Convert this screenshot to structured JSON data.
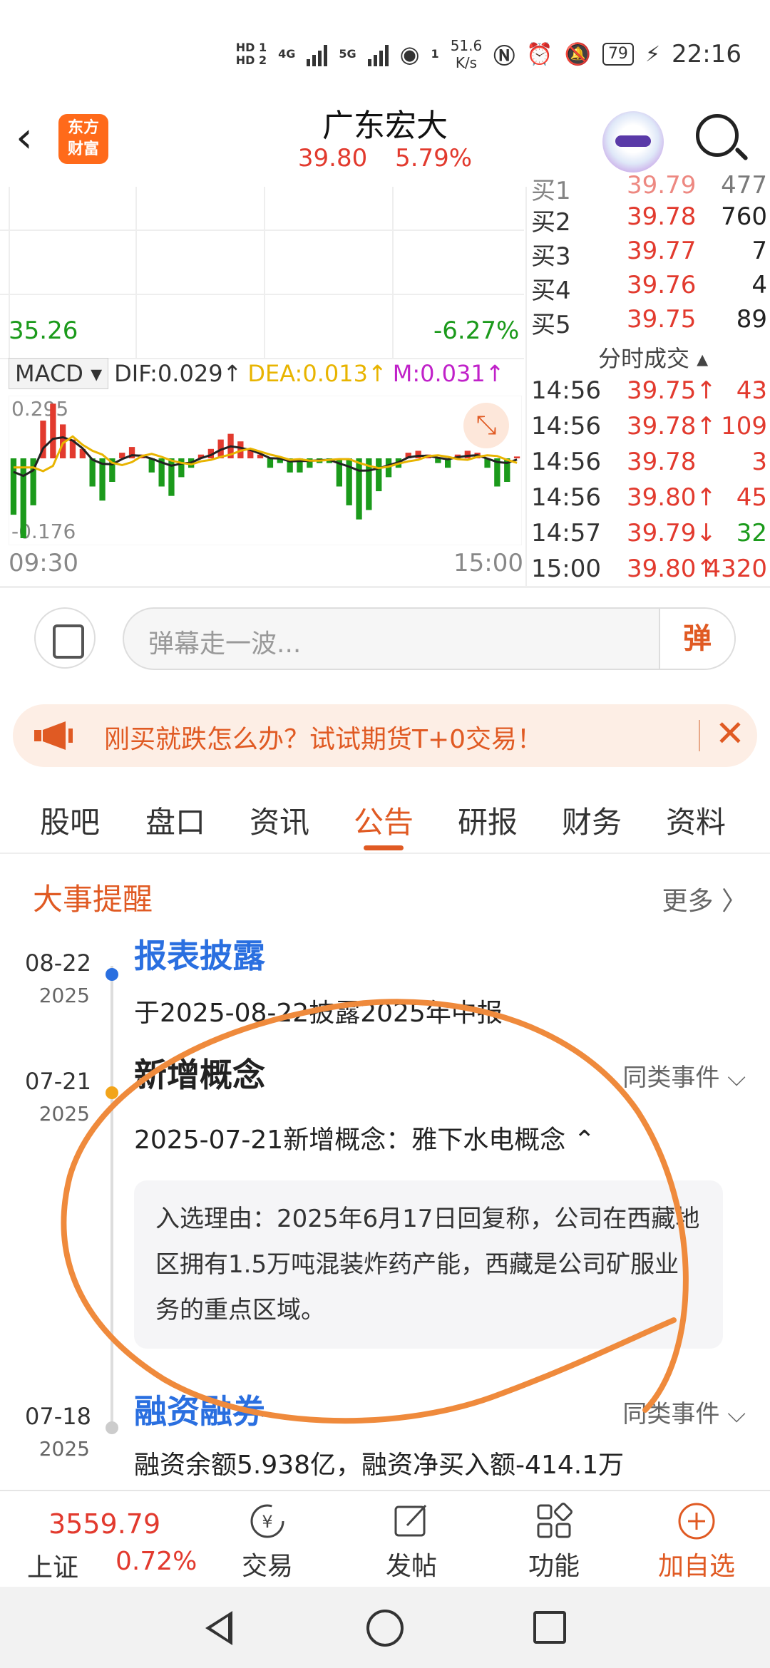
{
  "status_bar": {
    "hd1": "HD 1",
    "hd2": "HD 2",
    "net1": "4G",
    "net2": "5G",
    "wifi_sub": "1",
    "speed": "51.6",
    "speed_unit": "K/s",
    "battery": "79",
    "time": "22:16"
  },
  "header": {
    "logo_text": "东方\n财富",
    "stock_name": "广东宏大",
    "price": "39.80",
    "change_pct": "5.79%"
  },
  "chart": {
    "low_price": "35.26",
    "low_pct": "-6.27%",
    "indicator": "MACD",
    "dif": "DIF:0.029↑",
    "dea": "DEA:0.013↑",
    "m": "M:0.031↑",
    "macd_max": "0.295",
    "macd_min": "-0.176",
    "time_start": "09:30",
    "time_end": "15:00"
  },
  "chart_data": {
    "type": "bar",
    "title": "MACD",
    "xlabel": "",
    "ylabel": "",
    "x_range": [
      "09:30",
      "15:00"
    ],
    "ylim": [
      -0.176,
      0.295
    ],
    "series": [
      {
        "name": "MACD",
        "values": [
          -0.12,
          -0.17,
          -0.1,
          0.2,
          0.29,
          0.18,
          0.1,
          0.05,
          -0.06,
          -0.09,
          -0.05,
          0.03,
          0.06,
          0.02,
          -0.03,
          -0.06,
          -0.08,
          -0.04,
          -0.02,
          0.02,
          0.05,
          0.1,
          0.13,
          0.09,
          0.05,
          0.02,
          -0.02,
          -0.01,
          -0.03,
          -0.03,
          -0.02,
          -0.01,
          -0.01,
          -0.06,
          -0.1,
          -0.13,
          -0.11,
          -0.07,
          -0.04,
          -0.02,
          0.03,
          0.04,
          0.02,
          -0.01,
          -0.02,
          0.02,
          0.04,
          0.03,
          -0.02,
          -0.06,
          -0.05,
          0.01
        ]
      }
    ]
  },
  "order_book": {
    "partial_row": {
      "label": "买1",
      "price": "39.79",
      "vol": "477"
    },
    "rows": [
      {
        "label": "买2",
        "price": "39.78",
        "vol": "760"
      },
      {
        "label": "买3",
        "price": "39.77",
        "vol": "7"
      },
      {
        "label": "买4",
        "price": "39.76",
        "vol": "4"
      },
      {
        "label": "买5",
        "price": "39.75",
        "vol": "89"
      }
    ],
    "ticks_title": "分时成交 ▴",
    "ticks": [
      {
        "time": "14:56",
        "price": "39.75↑",
        "vol": "43",
        "dir": "up"
      },
      {
        "time": "14:56",
        "price": "39.78↑",
        "vol": "109",
        "dir": "up"
      },
      {
        "time": "14:56",
        "price": "39.78",
        "vol": "3",
        "dir": "up"
      },
      {
        "time": "14:56",
        "price": "39.80↑",
        "vol": "45",
        "dir": "up"
      },
      {
        "time": "14:57",
        "price": "39.79↓",
        "vol": "32",
        "dir": "down"
      },
      {
        "time": "15:00",
        "price": "39.80↑",
        "vol": "4320",
        "dir": "up"
      }
    ]
  },
  "danmu": {
    "placeholder": "弹幕走一波...",
    "send_label": "弹"
  },
  "ad": {
    "text": "刚买就跌怎么办？试试期货T+0交易！"
  },
  "tabs": [
    "股吧",
    "盘口",
    "资讯",
    "公告",
    "研报",
    "财务",
    "资料"
  ],
  "events": {
    "section_title": "大事提醒",
    "more": "更多 〉",
    "same_label": "同类事件 ⌵",
    "items": [
      {
        "date": "08-22",
        "year": "2025",
        "title": "报表披露",
        "desc": "于2025-08-22披露2025年中报"
      },
      {
        "date": "07-21",
        "year": "2025",
        "title": "新增概念",
        "desc": "2025-07-21新增概念：雅下水电概念 ⌃",
        "reason": "入选理由：2025年6月17日回复称，公司在西藏地区拥有1.5万吨混装炸药产能，西藏是公司矿服业务的重点区域。"
      },
      {
        "date": "07-18",
        "year": "2025",
        "title": "融资融券",
        "desc": "融资余额5.938亿，融资净买入额-414.1万"
      }
    ]
  },
  "bottom_bar": {
    "index_value": "3559.79",
    "index_name": "上证",
    "index_pct": "0.72%",
    "items": [
      {
        "label": "交易",
        "icon": "trade-icon"
      },
      {
        "label": "发帖",
        "icon": "post-icon"
      },
      {
        "label": "功能",
        "icon": "grid-icon"
      },
      {
        "label": "加自选",
        "icon": "add-circle-icon"
      }
    ]
  },
  "colors": {
    "accent": "#e05a23",
    "up": "#e23a2e",
    "down": "#1b9a1b",
    "dea": "#e8b400",
    "m": "#c021c9",
    "annotation": "#ef8a3c"
  }
}
